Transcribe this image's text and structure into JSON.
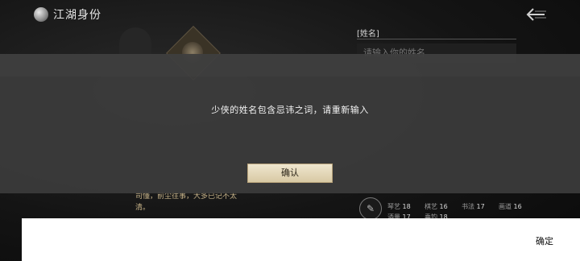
{
  "header": {
    "title": "江湖身份",
    "title_icon": "moon-swirl-icon",
    "back_icon": "back-arrow-icon"
  },
  "form": {
    "name_label": "[姓名]",
    "name_placeholder": "请输入你的姓名"
  },
  "bio": {
    "text": "司懂，前尘往事，大多已记不太清。"
  },
  "stats": [
    {
      "name": "琴艺",
      "value": "18"
    },
    {
      "name": "棋艺",
      "value": "16"
    },
    {
      "name": "书法",
      "value": "17"
    },
    {
      "name": "画道",
      "value": "16"
    },
    {
      "name": "酒量",
      "value": "17"
    },
    {
      "name": "垂钓",
      "value": "18"
    }
  ],
  "dialog": {
    "message": "少侠的姓名包含忌讳之词，请重新输入",
    "confirm_label": "确认"
  },
  "keyboard": {
    "done_label": "确定"
  },
  "colors": {
    "dialog_overlay": "#3c3c3c",
    "button_parchment": "#e6d9b8",
    "ime_bar": "#ffffff"
  }
}
